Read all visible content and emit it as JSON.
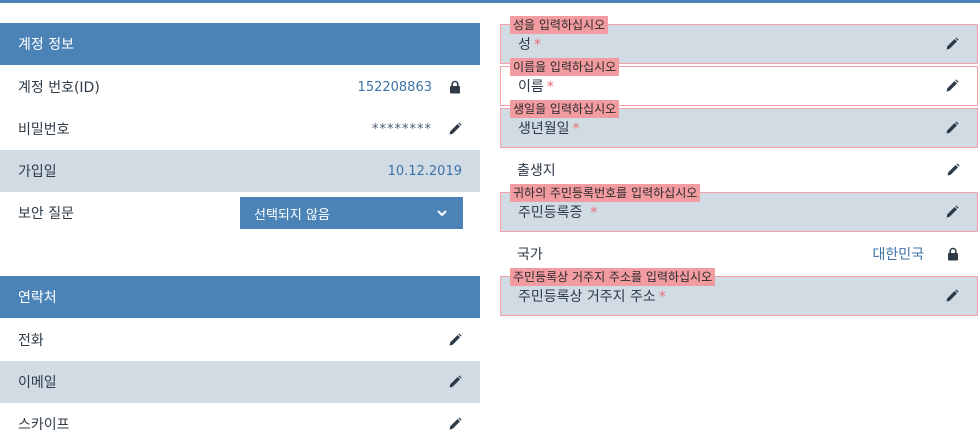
{
  "account": {
    "header": "계정 정보",
    "id_label": "계정 번호(ID)",
    "id_value": "152208863",
    "password_label": "비밀번호",
    "password_value": "********",
    "joined_label": "가입일",
    "joined_value": "10.12.2019",
    "security_label": "보안 질문",
    "security_select": "선택되지 않음"
  },
  "contact": {
    "header": "연락처",
    "phone_label": "전화",
    "email_label": "이메일",
    "skype_label": "스카이프"
  },
  "personal": {
    "surname": {
      "tip": "성을 입력하십시오",
      "label": "성",
      "req": "*"
    },
    "name": {
      "tip": "이름을 입력하십시오",
      "label": "이름",
      "req": "*"
    },
    "birthdate": {
      "tip": "생일을 입력하십시오",
      "label": "생년월일",
      "req": "*"
    },
    "birthplace": {
      "label": "출생지"
    },
    "idcard": {
      "tip": "귀하의 주민등록번호를 입력하십시오",
      "label": "주민등록증",
      "req": "*"
    },
    "country": {
      "label": "국가",
      "value": "대한민국"
    },
    "address": {
      "tip": "주민등록상 거주지 주소를 입력하십시오",
      "label": "주민등록상 거주지 주소",
      "req": "*"
    }
  },
  "colors": {
    "accent": "#4b83b7",
    "shade": "#d1dbe3",
    "error": "#f29ca2",
    "value_text": "#3d73a8"
  }
}
